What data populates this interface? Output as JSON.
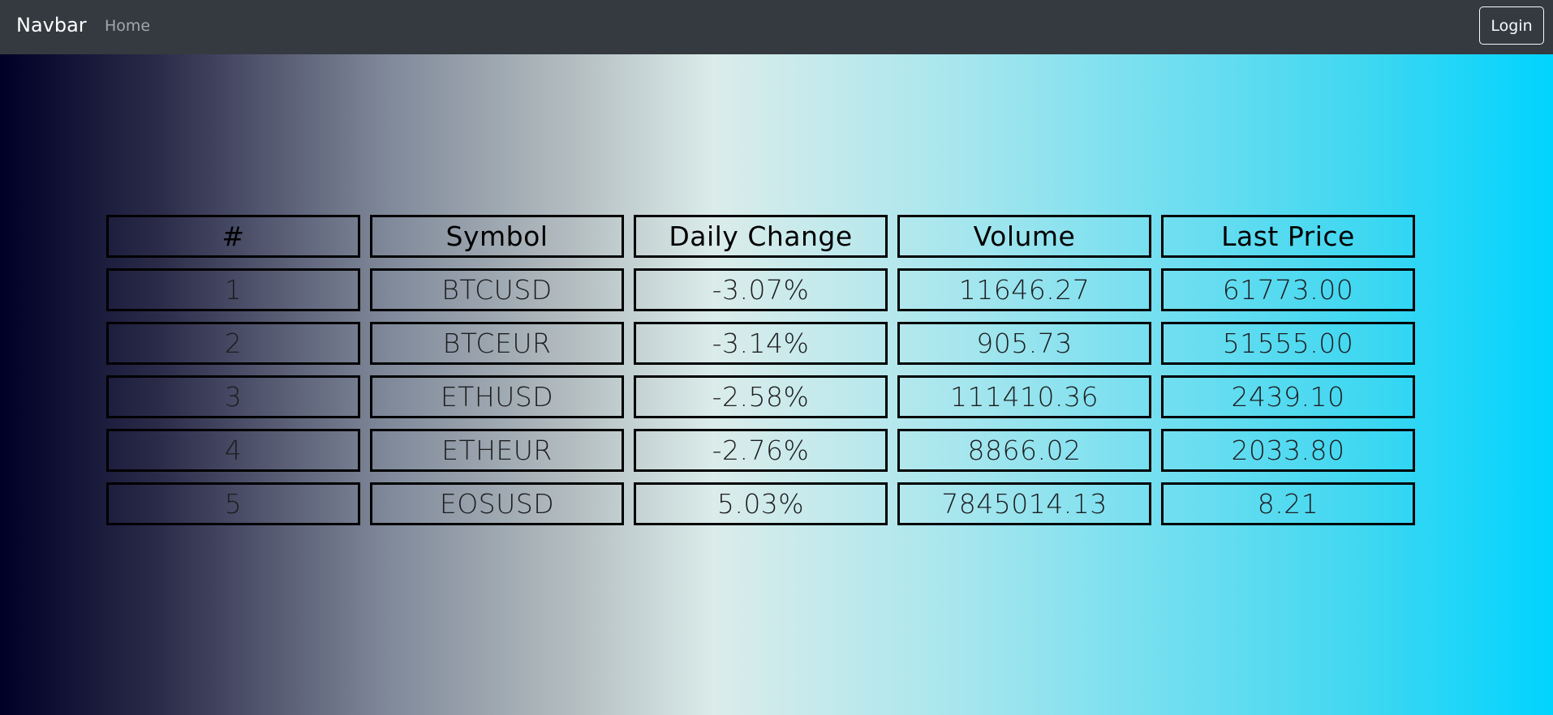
{
  "navbar": {
    "brand": "Navbar",
    "home_link": "Home",
    "login_label": "Login",
    "background": "#343a40"
  },
  "table": {
    "columns": [
      "#",
      "Symbol",
      "Daily Change",
      "Volume",
      "Last Price"
    ],
    "rows": [
      [
        "1",
        "BTCUSD",
        "-3.07%",
        "11646.27",
        "61773.00"
      ],
      [
        "2",
        "BTCEUR",
        "-3.14%",
        "905.73",
        "51555.00"
      ],
      [
        "3",
        "ETHUSD",
        "-2.58%",
        "111410.36",
        "2439.10"
      ],
      [
        "4",
        "ETHEUR",
        "-2.76%",
        "8866.02",
        "2033.80"
      ],
      [
        "5",
        "EOSUSD",
        "5.03%",
        "7845014.13",
        "8.21"
      ]
    ]
  },
  "colors": {
    "gradient_start": "#000028",
    "gradient_mid": "#dbecea",
    "gradient_end": "#00d4ff",
    "cell_border": "#000000"
  }
}
